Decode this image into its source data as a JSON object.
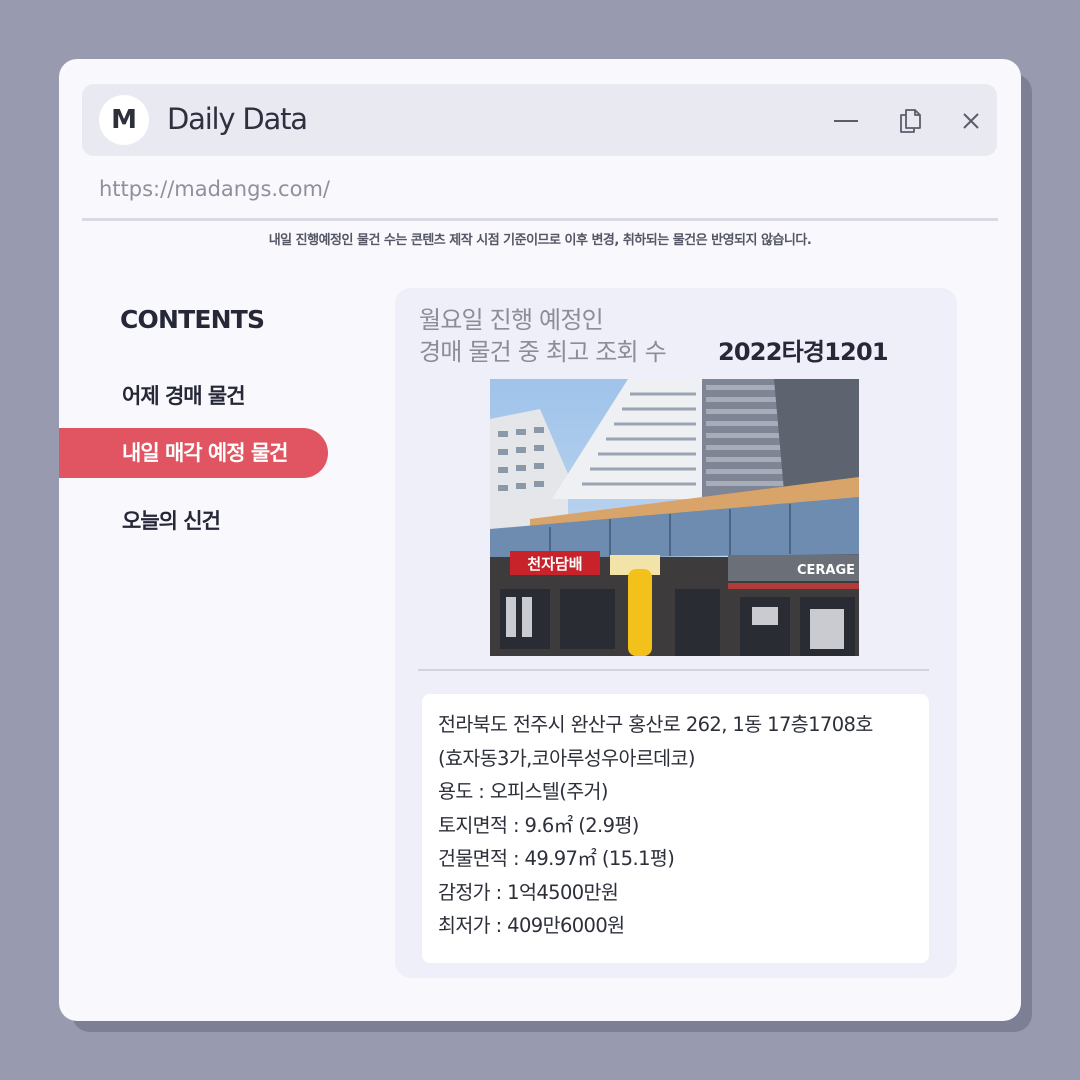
{
  "window": {
    "avatar_letter": "M",
    "app_title": "Daily Data",
    "url": "https://madangs.com/"
  },
  "notice": "내일 진행예정인 물건 수는 콘텐츠 제작 시점 기준이므로 이후 변경, 취하되는 물건은 반영되지 않습니다.",
  "sidebar": {
    "heading": "CONTENTS",
    "items": [
      {
        "label": "어제 경매 물건",
        "active": false
      },
      {
        "label": "내일 매각 예정 물건",
        "active": true
      },
      {
        "label": "오늘의 신건",
        "active": false
      }
    ]
  },
  "card": {
    "title_line1": "월요일 진행 예정인",
    "title_line2": "경매 물건 중 최고 조회 수",
    "case_number": "2022타경1201",
    "photo_signs": {
      "left": "천자담배",
      "right": "CERAGE"
    },
    "info": [
      "전라북도 전주시 완산구 홍산로 262, 1동 17층1708호",
      "(효자동3가,코아루성우아르데코)",
      "용도 : 오피스텔(주거)",
      "토지면적 : 9.6㎡ (2.9평)",
      "건물면적 : 49.97㎡ (15.1평)",
      "감정가 : 1억4500만원",
      "최저가 : 409만6000원"
    ]
  },
  "colors": {
    "background": "#989aaf",
    "accent": "#e05561",
    "window": "#f8f8fd",
    "titlebar": "#e8e9f1"
  },
  "icons": [
    "minimize-icon",
    "copy-icon",
    "close-icon"
  ]
}
